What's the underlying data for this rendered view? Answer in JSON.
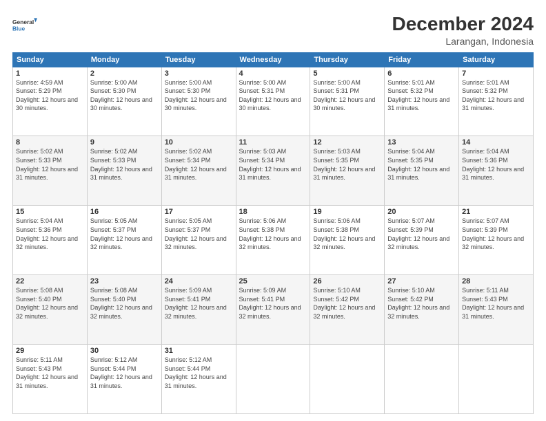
{
  "header": {
    "logo_line1": "General",
    "logo_line2": "Blue",
    "main_title": "December 2024",
    "subtitle": "Larangan, Indonesia"
  },
  "calendar": {
    "days_of_week": [
      "Sunday",
      "Monday",
      "Tuesday",
      "Wednesday",
      "Thursday",
      "Friday",
      "Saturday"
    ],
    "weeks": [
      [
        {
          "day": "1",
          "sunrise": "4:59 AM",
          "sunset": "5:29 PM",
          "daylight": "12 hours and 30 minutes."
        },
        {
          "day": "2",
          "sunrise": "5:00 AM",
          "sunset": "5:30 PM",
          "daylight": "12 hours and 30 minutes."
        },
        {
          "day": "3",
          "sunrise": "5:00 AM",
          "sunset": "5:30 PM",
          "daylight": "12 hours and 30 minutes."
        },
        {
          "day": "4",
          "sunrise": "5:00 AM",
          "sunset": "5:31 PM",
          "daylight": "12 hours and 30 minutes."
        },
        {
          "day": "5",
          "sunrise": "5:00 AM",
          "sunset": "5:31 PM",
          "daylight": "12 hours and 30 minutes."
        },
        {
          "day": "6",
          "sunrise": "5:01 AM",
          "sunset": "5:32 PM",
          "daylight": "12 hours and 31 minutes."
        },
        {
          "day": "7",
          "sunrise": "5:01 AM",
          "sunset": "5:32 PM",
          "daylight": "12 hours and 31 minutes."
        }
      ],
      [
        {
          "day": "8",
          "sunrise": "5:02 AM",
          "sunset": "5:33 PM",
          "daylight": "12 hours and 31 minutes."
        },
        {
          "day": "9",
          "sunrise": "5:02 AM",
          "sunset": "5:33 PM",
          "daylight": "12 hours and 31 minutes."
        },
        {
          "day": "10",
          "sunrise": "5:02 AM",
          "sunset": "5:34 PM",
          "daylight": "12 hours and 31 minutes."
        },
        {
          "day": "11",
          "sunrise": "5:03 AM",
          "sunset": "5:34 PM",
          "daylight": "12 hours and 31 minutes."
        },
        {
          "day": "12",
          "sunrise": "5:03 AM",
          "sunset": "5:35 PM",
          "daylight": "12 hours and 31 minutes."
        },
        {
          "day": "13",
          "sunrise": "5:04 AM",
          "sunset": "5:35 PM",
          "daylight": "12 hours and 31 minutes."
        },
        {
          "day": "14",
          "sunrise": "5:04 AM",
          "sunset": "5:36 PM",
          "daylight": "12 hours and 31 minutes."
        }
      ],
      [
        {
          "day": "15",
          "sunrise": "5:04 AM",
          "sunset": "5:36 PM",
          "daylight": "12 hours and 32 minutes."
        },
        {
          "day": "16",
          "sunrise": "5:05 AM",
          "sunset": "5:37 PM",
          "daylight": "12 hours and 32 minutes."
        },
        {
          "day": "17",
          "sunrise": "5:05 AM",
          "sunset": "5:37 PM",
          "daylight": "12 hours and 32 minutes."
        },
        {
          "day": "18",
          "sunrise": "5:06 AM",
          "sunset": "5:38 PM",
          "daylight": "12 hours and 32 minutes."
        },
        {
          "day": "19",
          "sunrise": "5:06 AM",
          "sunset": "5:38 PM",
          "daylight": "12 hours and 32 minutes."
        },
        {
          "day": "20",
          "sunrise": "5:07 AM",
          "sunset": "5:39 PM",
          "daylight": "12 hours and 32 minutes."
        },
        {
          "day": "21",
          "sunrise": "5:07 AM",
          "sunset": "5:39 PM",
          "daylight": "12 hours and 32 minutes."
        }
      ],
      [
        {
          "day": "22",
          "sunrise": "5:08 AM",
          "sunset": "5:40 PM",
          "daylight": "12 hours and 32 minutes."
        },
        {
          "day": "23",
          "sunrise": "5:08 AM",
          "sunset": "5:40 PM",
          "daylight": "12 hours and 32 minutes."
        },
        {
          "day": "24",
          "sunrise": "5:09 AM",
          "sunset": "5:41 PM",
          "daylight": "12 hours and 32 minutes."
        },
        {
          "day": "25",
          "sunrise": "5:09 AM",
          "sunset": "5:41 PM",
          "daylight": "12 hours and 32 minutes."
        },
        {
          "day": "26",
          "sunrise": "5:10 AM",
          "sunset": "5:42 PM",
          "daylight": "12 hours and 32 minutes."
        },
        {
          "day": "27",
          "sunrise": "5:10 AM",
          "sunset": "5:42 PM",
          "daylight": "12 hours and 32 minutes."
        },
        {
          "day": "28",
          "sunrise": "5:11 AM",
          "sunset": "5:43 PM",
          "daylight": "12 hours and 31 minutes."
        }
      ],
      [
        {
          "day": "29",
          "sunrise": "5:11 AM",
          "sunset": "5:43 PM",
          "daylight": "12 hours and 31 minutes."
        },
        {
          "day": "30",
          "sunrise": "5:12 AM",
          "sunset": "5:44 PM",
          "daylight": "12 hours and 31 minutes."
        },
        {
          "day": "31",
          "sunrise": "5:12 AM",
          "sunset": "5:44 PM",
          "daylight": "12 hours and 31 minutes."
        },
        null,
        null,
        null,
        null
      ]
    ]
  }
}
